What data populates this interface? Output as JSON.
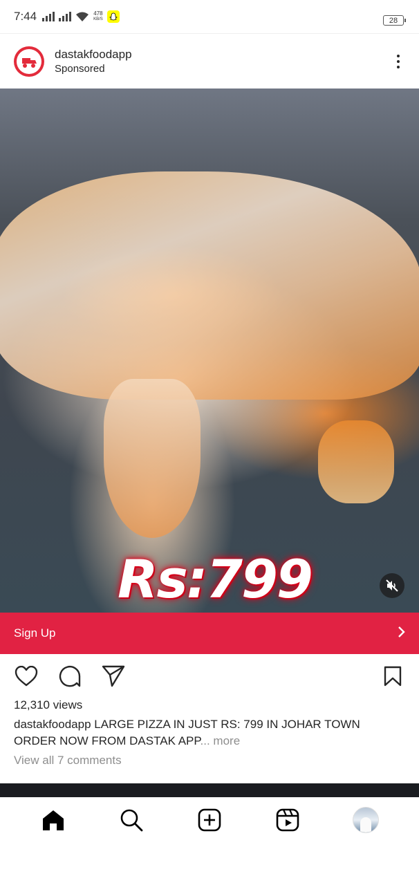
{
  "status_bar": {
    "time": "7:44",
    "net_speed_value": "478",
    "net_speed_unit": "KB/S",
    "battery": "28"
  },
  "post": {
    "username": "dastakfoodapp",
    "sponsored_label": "Sponsored",
    "avatar_icon": "dastak-logo-icon",
    "media": {
      "overlay_price": "Rs:799",
      "muted": true
    },
    "cta": {
      "label": "Sign Up"
    },
    "views": "12,310 views",
    "caption": {
      "username": "dastakfoodapp",
      "text": " LARGE PIZZA IN JUST RS: 799 IN JOHAR TOWN ORDER NOW FROM DASTAK APP",
      "more": "... more"
    },
    "comments_link": "View all 7 comments"
  },
  "colors": {
    "cta_background": "#e12243",
    "avatar_ring": "#e32b3b",
    "text_primary": "#262626",
    "text_secondary": "#8e8e8e"
  },
  "bottom_nav": {
    "items": [
      "home",
      "search",
      "create",
      "reels",
      "profile"
    ],
    "active": "home"
  }
}
